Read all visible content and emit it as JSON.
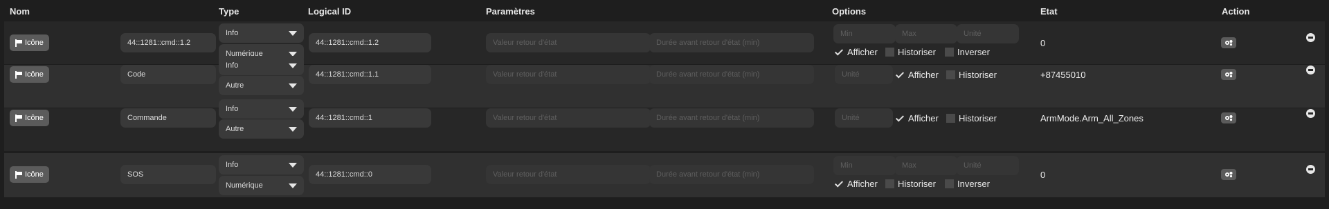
{
  "headers": {
    "nom": "Nom",
    "type": "Type",
    "logical_id": "Logical ID",
    "parametres": "Paramètres",
    "options": "Options",
    "etat": "Etat",
    "action": "Action"
  },
  "placeholders": {
    "valeur_retour": "Valeur retour d'état",
    "duree_retour": "Durée avant retour d'état (min)",
    "min": "Min",
    "max": "Max",
    "unite": "Unité"
  },
  "labels": {
    "icone": "Icône",
    "afficher": "Afficher",
    "historiser": "Historiser",
    "inverser": "Inverser"
  },
  "rows": [
    {
      "name": "44::1281::cmd::1.2",
      "type": "Info",
      "subtype": "Numérique",
      "logical_id": "44::1281::cmd::1.2",
      "etat": "0",
      "afficher": true,
      "historiser": false,
      "inverser": false
    },
    {
      "name": "Code",
      "type": "Info",
      "subtype": "Autre",
      "logical_id": "44::1281::cmd::1.1",
      "etat": "+87455010",
      "afficher": true,
      "historiser": false
    },
    {
      "name": "Commande",
      "type": "Info",
      "subtype": "Autre",
      "logical_id": "44::1281::cmd::1",
      "etat": "ArmMode.Arm_All_Zones",
      "afficher": true,
      "historiser": false
    },
    {
      "name": "SOS",
      "type": "Info",
      "subtype": "Numérique",
      "logical_id": "44::1281::cmd::0",
      "etat": "0",
      "afficher": true,
      "historiser": false,
      "inverser": false
    }
  ]
}
